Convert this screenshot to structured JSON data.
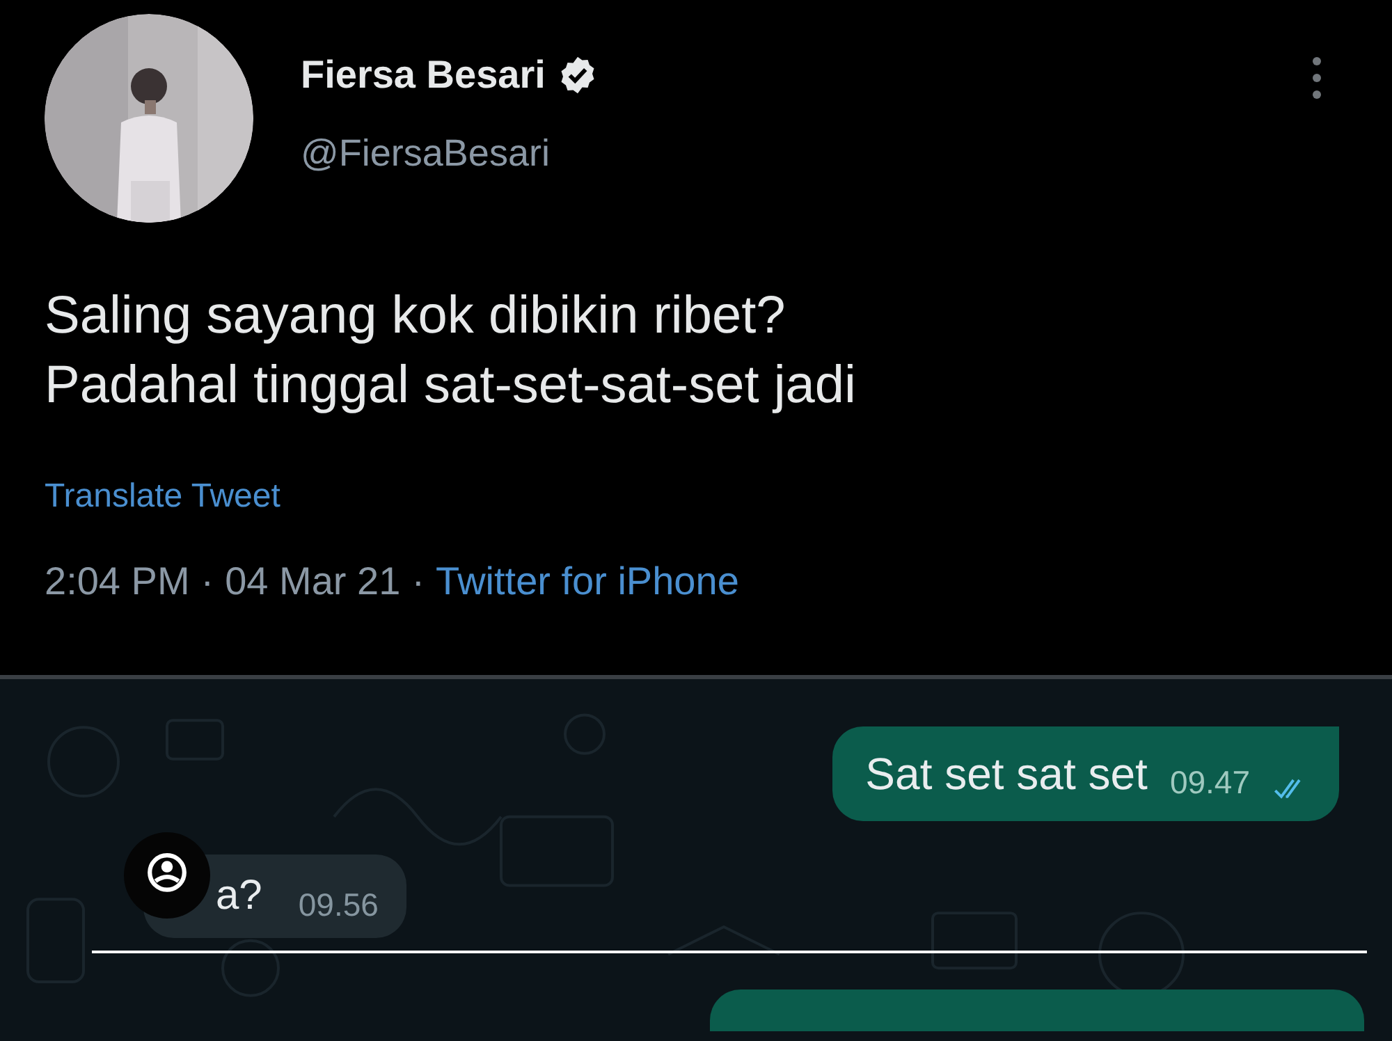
{
  "tweet": {
    "author": {
      "name": "Fiersa Besari",
      "verified": true,
      "handle": "@FiersaBesari"
    },
    "text_lines": [
      "Saling sayang kok dibikin ribet?",
      "Padahal tinggal sat-set-sat-set jadi"
    ],
    "translate_link": "Translate Tweet",
    "meta": [
      {
        "kind": "plain",
        "text": "2:04 PM"
      },
      {
        "kind": "plain",
        "text": "·"
      },
      {
        "kind": "plain",
        "text": "04 Mar 21"
      },
      {
        "kind": "plain",
        "text": "·"
      },
      {
        "kind": "link",
        "text": "Twitter for iPhone"
      }
    ]
  },
  "chat": {
    "messages": [
      {
        "kind": "sent",
        "text": "Sat set sat set",
        "time": "09.47",
        "read": true
      },
      {
        "kind": "received",
        "text": "a?",
        "time": "09.56"
      },
      {
        "kind": "sent_partial"
      }
    ]
  }
}
